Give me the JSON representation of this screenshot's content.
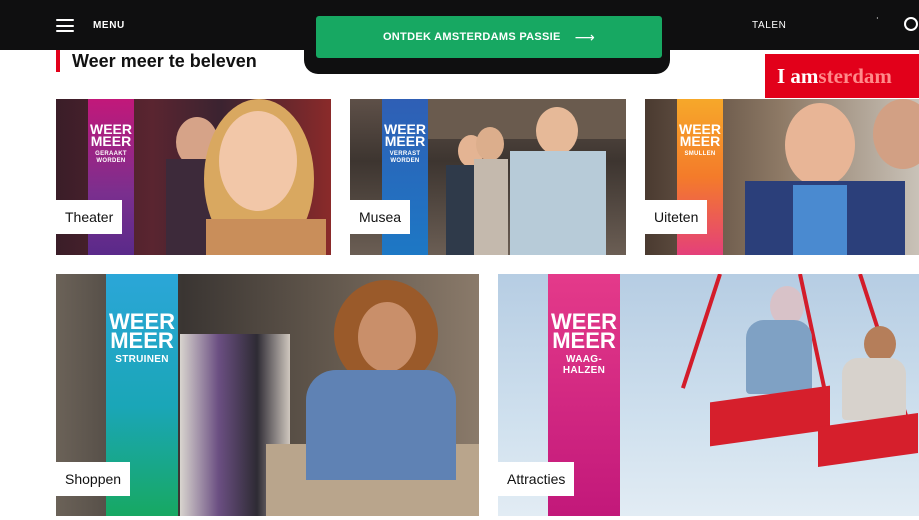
{
  "nav": {
    "menu_label": "MENU",
    "cta_label": "ONTDEK AMSTERDAMS PASSIE",
    "cta_arrow": "⟶",
    "languages_label": "TALEN",
    "languages_caret": "˙",
    "cta_color": "#17a862"
  },
  "logo": {
    "part1": "I am",
    "part2": "sterdam"
  },
  "section": {
    "title": "Weer meer te beleven"
  },
  "tiles": [
    {
      "label": "Theater",
      "weer": "WEER",
      "meer": "MEER",
      "sub": "GERAAKT WORDEN"
    },
    {
      "label": "Musea",
      "weer": "WEER",
      "meer": "MEER",
      "sub": "VERRAST WORDEN"
    },
    {
      "label": "Uiteten",
      "weer": "WEER",
      "meer": "MEER",
      "sub": "SMULLEN"
    },
    {
      "label": "Shoppen",
      "weer": "WEER",
      "meer": "MEER",
      "sub": "STRUINEN"
    },
    {
      "label": "Attracties",
      "weer": "WEER",
      "meer": "MEER",
      "sub": "WAAG-HALZEN"
    }
  ],
  "colors": {
    "theater_stripe": "#7b2f8e",
    "musea_stripe": "#1d78c5",
    "uiteten_stripe": "#f47b2a",
    "shoppen_stripe": "#1aa6b7",
    "attracties_stripe": "#c2187a"
  }
}
